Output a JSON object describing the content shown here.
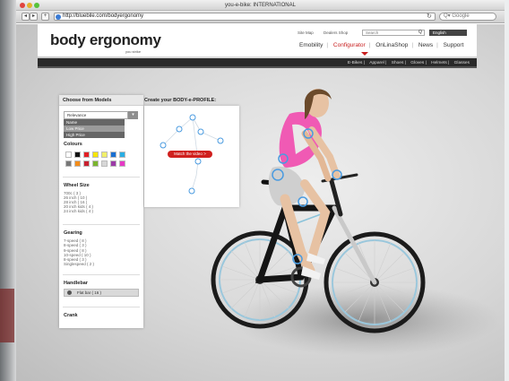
{
  "window": {
    "title": "you-e-bike: INTERNATIONAL",
    "url": "http://bluebile.com/bodyergonomy",
    "search_placeholder": "Q▾ Google",
    "back_glyph": "◂",
    "forward_glyph": "▸",
    "add_glyph": "+",
    "reload_glyph": "↻"
  },
  "site": {
    "logo_text": "body ergonomy",
    "logo_tagline": "you strike",
    "util_links": [
      "Site Map",
      "Dealers Shop"
    ],
    "search_placeholder": "Search",
    "search_icon": "Q",
    "language": "English",
    "main_nav": [
      "Emobility",
      "Configurator",
      "OnLinaShop",
      "News",
      "Support"
    ],
    "active_nav": "Configurator",
    "categories": [
      "E-Bikes",
      "Apparel",
      "Shoes",
      "Gloves",
      "Helmets",
      "Glasses"
    ]
  },
  "filters": {
    "title": "Choose from Models",
    "sort_value": "Relevance",
    "sort_button": "▾",
    "sort_options": [
      "Name",
      "Low Price",
      "High Price"
    ],
    "colours_title": "Colours",
    "colours_row1": [
      "#ffffff",
      "#111111",
      "#e31e24",
      "#f6e500",
      "#f1ef6a",
      "#1a6fd1",
      "#2aaee4"
    ],
    "colours_row2": [
      "#777777",
      "#f28c1b",
      "#c8202f",
      "#7bb52f",
      "#d7d7d7",
      "#9b3aa7",
      "#e639c5"
    ],
    "wheel_title": "Wheel Size",
    "wheel_sizes": [
      "700c ( 3 )",
      "26 inch ( 10 )",
      "28 inch ( 16 )",
      "20 inch kids ( 4 )",
      "24 inch kids ( 4 )"
    ],
    "gearing_title": "Gearing",
    "gearing": [
      "7-speed ( 8 )",
      "8-speed ( 3 )",
      "9-speed ( 8 )",
      "10-speed ( 10 )",
      "8-speed ( 3 )",
      "Singlespeed ( 2 )"
    ],
    "handlebar_title": "Handlebar",
    "handlebar_item": "Flat bar ( 16 )",
    "crank_title": "Crank"
  },
  "profile": {
    "title": "Create your BODY-e-PROFILE:",
    "match_button": "Match the video >"
  }
}
